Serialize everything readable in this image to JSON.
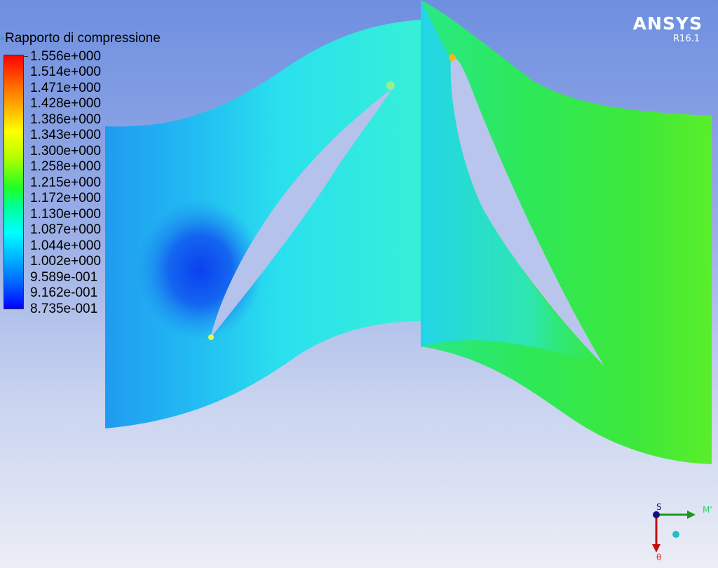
{
  "legend": {
    "title": "Rapporto di compressione",
    "values": [
      "1.556e+000",
      "1.514e+000",
      "1.471e+000",
      "1.428e+000",
      "1.386e+000",
      "1.343e+000",
      "1.300e+000",
      "1.258e+000",
      "1.215e+000",
      "1.172e+000",
      "1.130e+000",
      "1.087e+000",
      "1.044e+000",
      "1.002e+000",
      "9.589e-001",
      "9.162e-001",
      "8.735e-001"
    ]
  },
  "branding": {
    "name": "ANSYS",
    "version": "R16.1"
  },
  "triad": {
    "s_label": "S",
    "m_label": "M'",
    "theta_label": "θ"
  },
  "colors": {
    "legend_max": "#ff0000",
    "legend_min": "#0000ff",
    "blade_row_1": "#2fd6f2",
    "blade_row_2": "#2ee85a"
  }
}
